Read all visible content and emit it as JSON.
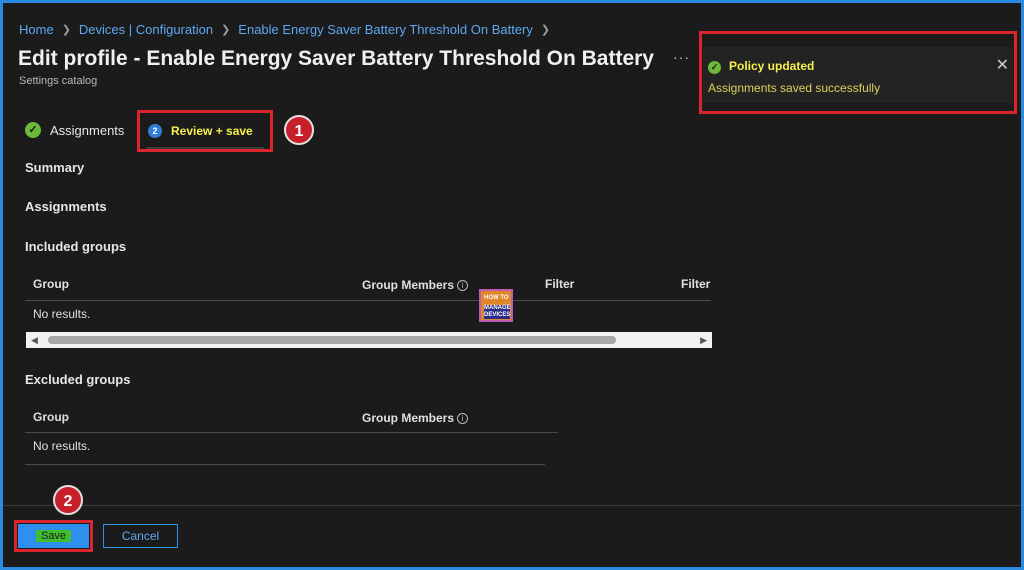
{
  "breadcrumb": [
    "Home",
    "Devices | Configuration",
    "Enable Energy Saver Battery Threshold On Battery"
  ],
  "page": {
    "title": "Edit profile - Enable Energy Saver Battery Threshold On Battery",
    "subtitle": "Settings catalog",
    "more": "···"
  },
  "toast": {
    "title": "Policy updated",
    "message": "Assignments saved successfully",
    "close": "✕",
    "check": "✓"
  },
  "steps": [
    {
      "label": "Assignments",
      "marker": "✓"
    },
    {
      "label": "Review + save",
      "marker": "2"
    }
  ],
  "annotations": {
    "badge1": "1",
    "badge2": "2"
  },
  "sections": {
    "summary": "Summary",
    "assignments": "Assignments",
    "included": "Included groups",
    "excluded": "Excluded groups"
  },
  "included_table": {
    "columns": [
      "Group",
      "Group Members",
      "Filter",
      "Filter"
    ],
    "empty": "No results."
  },
  "excluded_table": {
    "columns": [
      "Group",
      "Group Members"
    ],
    "empty": "No results."
  },
  "watermark": {
    "line1": "HOW TO",
    "line2": "MANAGE DEVICES"
  },
  "footer": {
    "save": "Save",
    "cancel": "Cancel"
  },
  "colors": {
    "accent": "#2f8fef",
    "highlight_box": "#d9252b",
    "success": "#6bb83a",
    "highlight_text": "#f5f04a"
  }
}
